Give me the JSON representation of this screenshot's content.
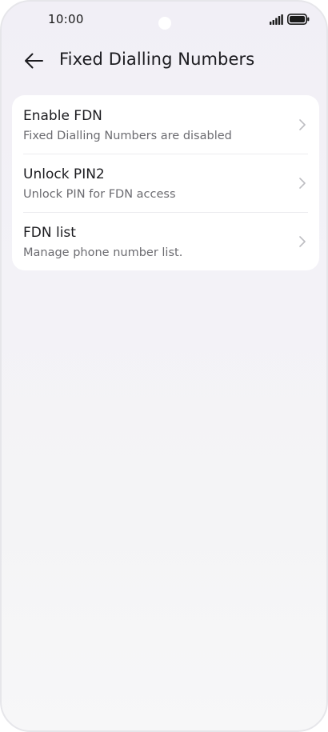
{
  "status_bar": {
    "time": "10:00",
    "icons": [
      "signal-icon",
      "battery-icon"
    ]
  },
  "header": {
    "back_icon": "arrow-left-icon",
    "title": "Fixed Dialling Numbers"
  },
  "items": [
    {
      "title": "Enable FDN",
      "subtitle": "Fixed Dialling Numbers are disabled",
      "icon": "chevron-right-icon"
    },
    {
      "title": "Unlock PIN2",
      "subtitle": "Unlock PIN for FDN access",
      "icon": "chevron-right-icon"
    },
    {
      "title": "FDN list",
      "subtitle": "Manage phone number list.",
      "icon": "chevron-right-icon"
    }
  ],
  "colors": {
    "text_primary": "#1b1b1f",
    "text_secondary": "#6b6b70",
    "card_background": "#ffffff",
    "chevron": "#bdbdc2"
  }
}
